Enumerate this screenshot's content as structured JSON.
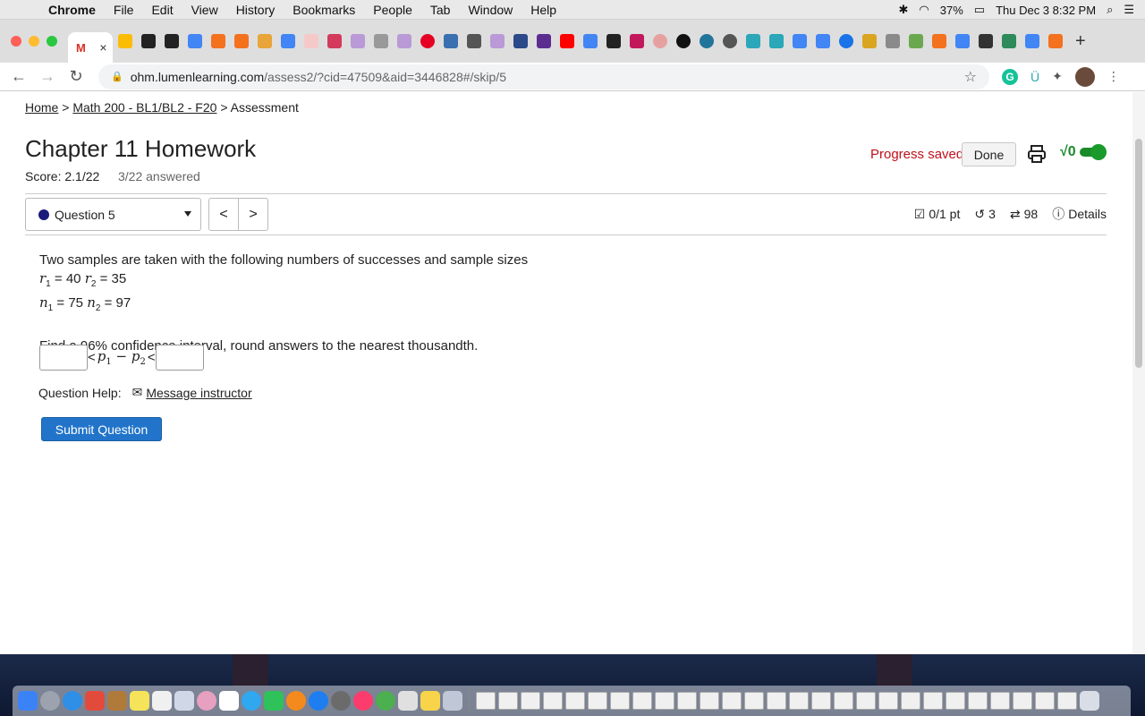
{
  "menubar": {
    "app": "Chrome",
    "items": [
      "File",
      "Edit",
      "View",
      "History",
      "Bookmarks",
      "People",
      "Tab",
      "Window",
      "Help"
    ],
    "battery": "37%",
    "clock": "Thu Dec 3  8:32 PM"
  },
  "browser": {
    "url_host": "ohm.lumenlearning.com",
    "url_path": "/assess2/?cid=47509&aid=3446828#/skip/5"
  },
  "page": {
    "breadcrumb": {
      "home": "Home",
      "course": "Math 200 - BL1/BL2 - F20",
      "current": "Assessment",
      "sep": ">"
    },
    "title": "Chapter 11 Homework",
    "score": "Score: 2.1/22",
    "answered": "3/22 answered",
    "progress_saved": "Progress saved",
    "done_label": "Done",
    "sqrt_label": "√0"
  },
  "question": {
    "selector_label": "Question 5",
    "prev_label": "<",
    "next_label": ">",
    "points": "0/1 pt",
    "retries": "3",
    "attempts": "98",
    "details_label": "Details",
    "intro": "Two samples are taken with the following numbers of successes and sample sizes",
    "r_line": {
      "r1_var": "r",
      "r1_sub": "1",
      "r1_val": " = 40 ",
      "r2_var": "r",
      "r2_sub": "2",
      "r2_val": " = 35"
    },
    "n_line": {
      "n1_var": "n",
      "n1_sub": "1",
      "n1_val": " = 75 ",
      "n2_var": "n",
      "n2_sub": "2",
      "n2_val": " = 97"
    },
    "prompt": "Find a 96% confidence interval, round answers to the nearest thousandth.",
    "lower_value": "",
    "upper_value": "",
    "lt1": "<",
    "lt2": "<",
    "expr_p1": "p",
    "expr_p1_sub": "1",
    "expr_minus": " − ",
    "expr_p2": "p",
    "expr_p2_sub": "2",
    "help_label": "Question Help:",
    "message_label": "Message instructor",
    "submit_label": "Submit Question"
  },
  "colors": {
    "accent_purple": "#4b2c8f",
    "saved_red": "#c0101a",
    "submit_blue": "#2174c9",
    "toggle_green": "#1a8a2a"
  }
}
